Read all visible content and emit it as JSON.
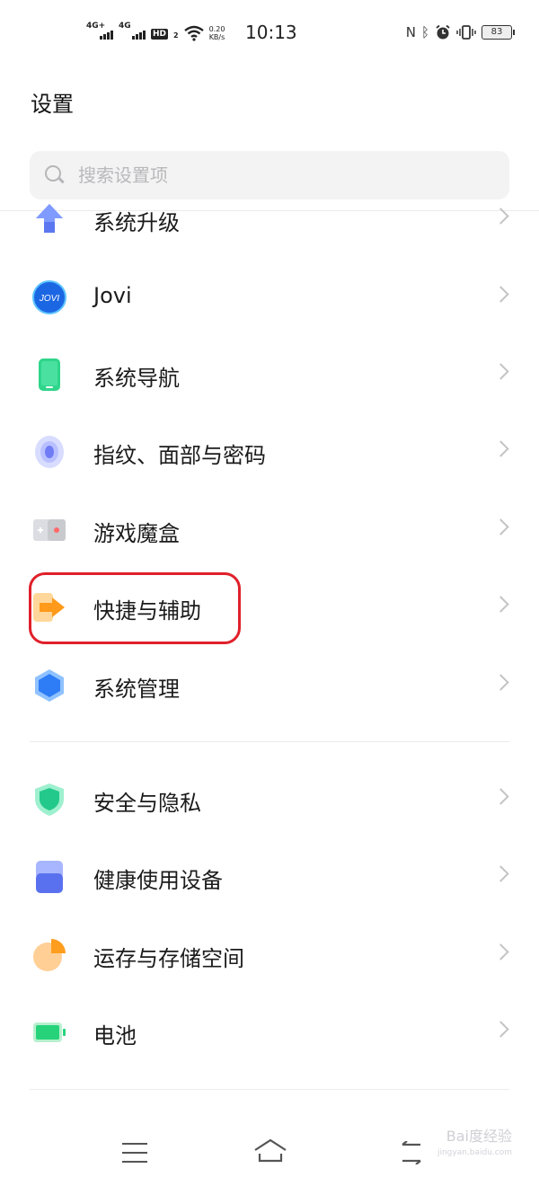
{
  "status_bar": {
    "sim1_net": "4G+",
    "sim2_net": "4G",
    "hd_badge": "HD",
    "hd_sim": "2",
    "net_speed_value": "0.20",
    "net_speed_unit": "KB/s",
    "time": "10:13",
    "battery": "83"
  },
  "page": {
    "title": "设置"
  },
  "search": {
    "placeholder": "搜索设置项"
  },
  "settings_list": [
    {
      "label": "系统升级",
      "icon": "system-upgrade-icon"
    },
    {
      "label": "Jovi",
      "icon": "jovi-icon"
    },
    {
      "label": "系统导航",
      "icon": "system-navigation-icon"
    },
    {
      "label": "指纹、面部与密码",
      "icon": "fingerprint-icon"
    },
    {
      "label": "游戏魔盒",
      "icon": "game-box-icon"
    },
    {
      "label": "快捷与辅助",
      "icon": "shortcuts-assist-icon"
    },
    {
      "label": "系统管理",
      "icon": "system-management-icon"
    },
    {
      "label": "安全与隐私",
      "icon": "security-shield-icon"
    },
    {
      "label": "健康使用设备",
      "icon": "healthy-usage-icon"
    },
    {
      "label": "运存与存储空间",
      "icon": "storage-pie-icon"
    },
    {
      "label": "电池",
      "icon": "battery-icon"
    }
  ],
  "jovi_icon_text": "Jovi",
  "highlight_color": "#e0202a",
  "watermark": {
    "brand": "Bai度经验",
    "url": "jingyan.baidu.com"
  }
}
